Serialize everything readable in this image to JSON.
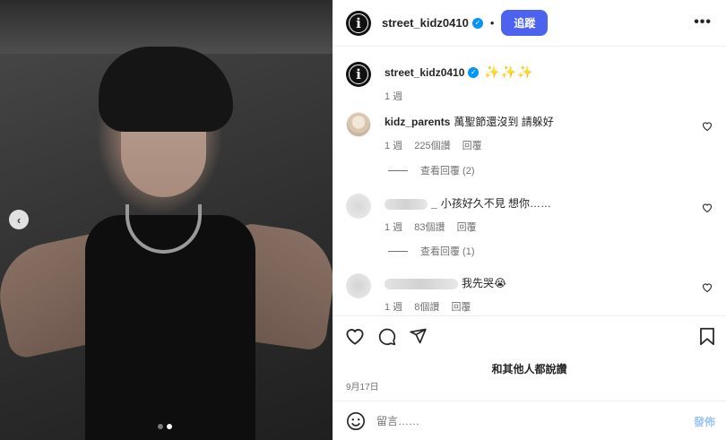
{
  "post": {
    "author": "street_kidz0410",
    "follow_label": "追蹤",
    "more_label": "•••",
    "carousel_prev": "‹"
  },
  "caption": {
    "author": "street_kidz0410",
    "text": "✨✨✨",
    "time": "1 週"
  },
  "comments": [
    {
      "author": "kidz_parents",
      "text": "萬聖節還沒到 請躲好",
      "time": "1 週",
      "likes": "225個讚",
      "reply": "回覆",
      "view_replies": "查看回覆 (2)"
    },
    {
      "author_visible": "_",
      "text": "小孩好久不見 想你……",
      "time": "1 週",
      "likes": "83個讚",
      "reply": "回覆",
      "view_replies": "查看回覆 (1)"
    },
    {
      "author_visible": "",
      "text": "我先哭😭",
      "time": "1 週",
      "likes": "8個讚",
      "reply": "回覆"
    }
  ],
  "likes_text": "和其他人都說讚",
  "date": "9月17日",
  "comment_box": {
    "placeholder": "留言……",
    "post_label": "發佈"
  }
}
